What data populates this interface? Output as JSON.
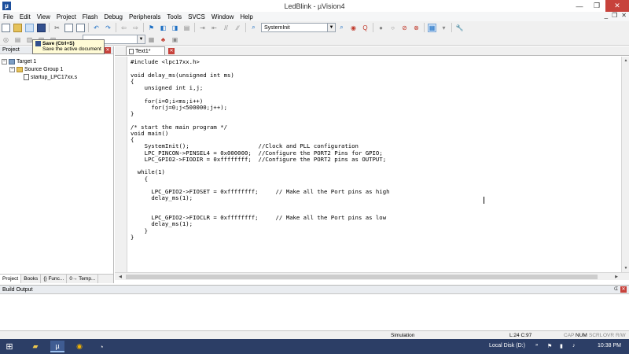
{
  "window": {
    "title": "LedBlink - µVision4",
    "app_icon": "uvision-icon",
    "controls": [
      "—",
      "❐",
      "✕"
    ]
  },
  "menu": {
    "items": [
      "File",
      "Edit",
      "View",
      "Project",
      "Flash",
      "Debug",
      "Peripherals",
      "Tools",
      "SVCS",
      "Window",
      "Help"
    ],
    "mdi_controls": [
      "_",
      "❐",
      "✕"
    ]
  },
  "toolbar": {
    "find_combo_value": "SystemInit",
    "target_combo_value": ""
  },
  "tooltip": {
    "title": "Save (Ctrl+S)",
    "description": "Save the active document"
  },
  "project_panel": {
    "header": "Project",
    "tree": {
      "target": "Target 1",
      "group": "Source Group 1",
      "file": "startup_LPC17xx.s"
    },
    "tabs": [
      "Project",
      "Books",
      "{} Func...",
      "0→ Temp..."
    ]
  },
  "editor": {
    "tab_label": "Text1*",
    "code": "#include <lpc17xx.h>\n\nvoid delay_ms(unsigned int ms)\n{\n    unsigned int i,j;\n\n    for(i=0;i<ms;i++)\n      for(j=0;j<500000;j++);\n}\n\n/* start the main program */\nvoid main()\n{\n    SystemInit();                    //Clock and PLL configuration\n    LPC_PINCON->PINSEL4 = 0x000000;  //Configure the PORT2 Pins for GPIO;\n    LPC_GPIO2->FIODIR = 0xffffffff;  //Configure the PORT2 pins as OUTPUT;\n\n  while(1)\n    {\n\n      LPC_GPIO2->FIOSET = 0xffffffff;     // Make all the Port pins as high\n      delay_ms(1);\n\n\n      LPC_GPIO2->FIOCLR = 0xffffffff;     // Make all the Port pins as low\n      delay_ms(1);\n    }\n}"
  },
  "build_output": {
    "header": "Build Output"
  },
  "status": {
    "mode": "Simulation",
    "position": "L:24 C:97",
    "indicators": [
      "CAP",
      "NUM",
      "SCRL",
      "OVR",
      "R/W"
    ]
  },
  "taskbar": {
    "items": [
      "windows-start",
      "file-explorer",
      "uvision",
      "chrome",
      "paint"
    ],
    "drive_label": "Local Disk (D:)",
    "time": "10:38 PM"
  }
}
